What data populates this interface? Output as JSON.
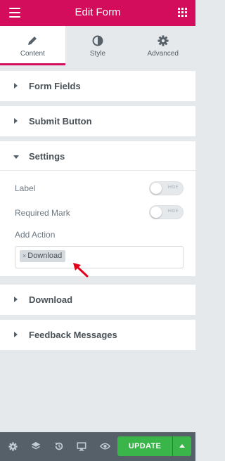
{
  "header": {
    "title": "Edit Form"
  },
  "tabs": [
    {
      "label": "Content",
      "icon": "pencil-icon",
      "active": true
    },
    {
      "label": "Style",
      "icon": "half-circle-icon",
      "active": false
    },
    {
      "label": "Advanced",
      "icon": "gear-icon",
      "active": false
    }
  ],
  "sections": {
    "form_fields": "Form Fields",
    "submit_button": "Submit Button",
    "settings": "Settings",
    "download": "Download",
    "feedback": "Feedback Messages"
  },
  "settings": {
    "label_label": "Label",
    "label_switch": "HIDE",
    "required_label": "Required Mark",
    "required_switch": "HIDE",
    "add_action_label": "Add Action",
    "actions": [
      "Download"
    ],
    "chip_remove": "×"
  },
  "footer": {
    "update_label": "UPDATE"
  },
  "colors": {
    "brand": "#d30c5c",
    "update": "#39b54a",
    "annotation_arrow": "#e4001b"
  }
}
